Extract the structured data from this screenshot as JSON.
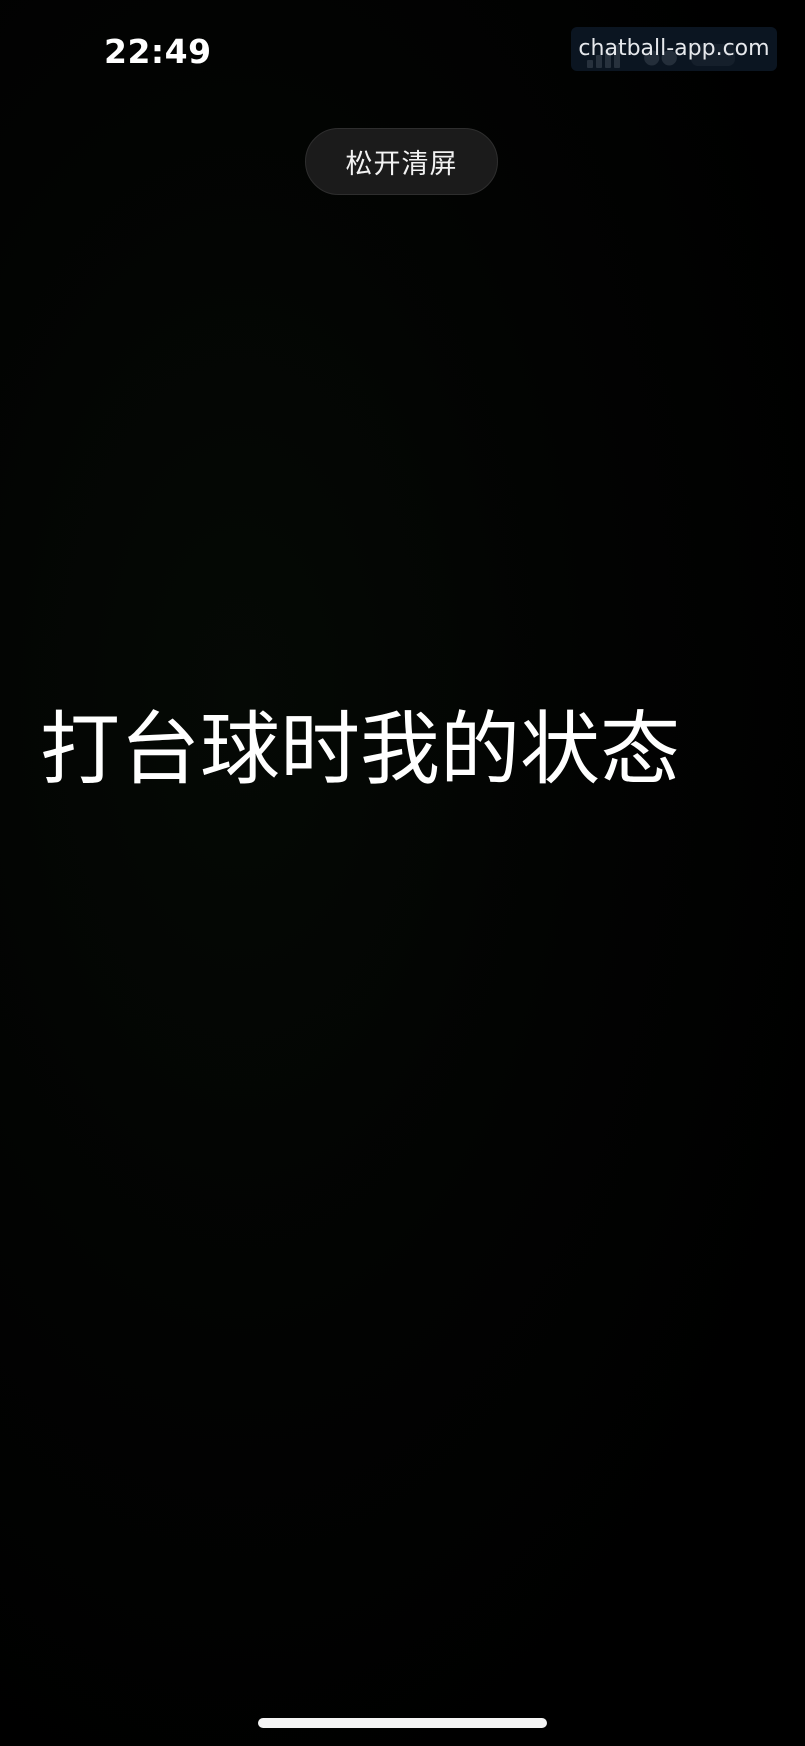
{
  "status_bar": {
    "time": "22:49",
    "icons": [
      "signal-icon",
      "wifi-icon",
      "battery-icon"
    ]
  },
  "watermark": {
    "text": "chatball-app.com"
  },
  "clear_pill": {
    "label": "松开清屏"
  },
  "caption": {
    "text": "打台球时我的状态"
  },
  "colors": {
    "background": "#000000",
    "text": "#ffffff",
    "pill_background": "#1b1b1b",
    "watermark_background": "#0e1a28"
  }
}
